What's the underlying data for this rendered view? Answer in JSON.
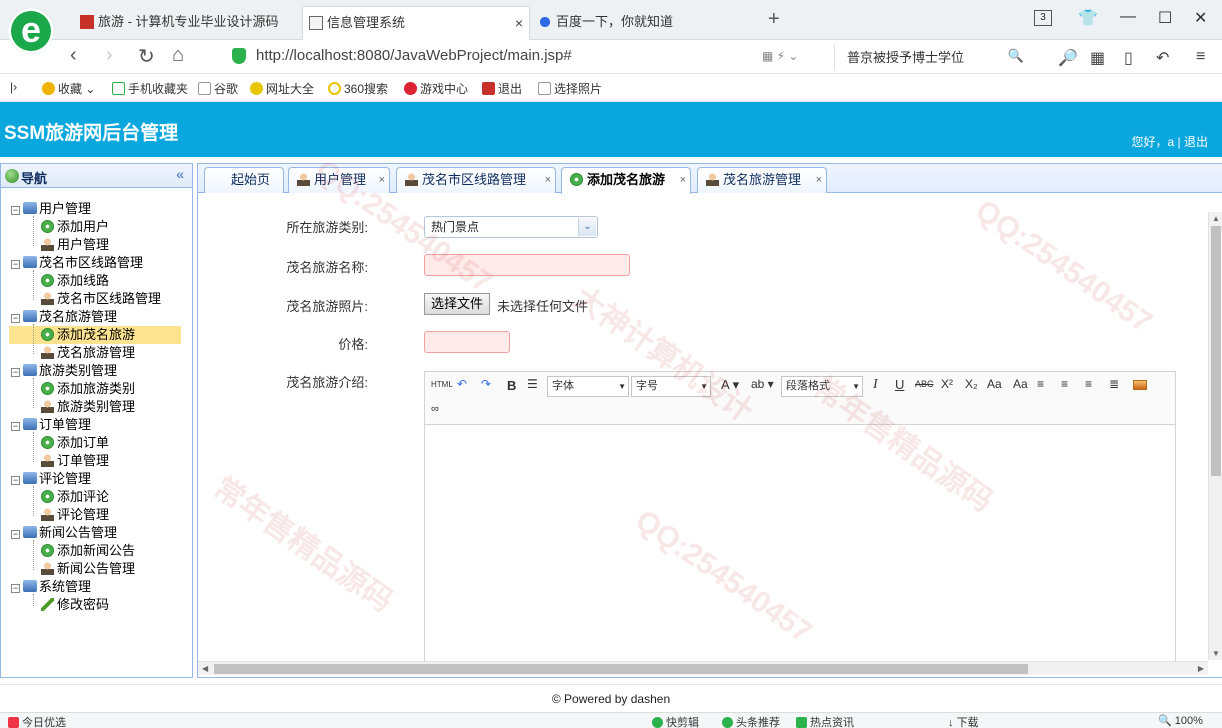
{
  "browser": {
    "tabs": [
      {
        "title": "旅游 - 计算机专业毕业设计源码",
        "active": false
      },
      {
        "title": "信息管理系统",
        "active": true
      },
      {
        "title": "百度一下，你就知道",
        "active": false
      }
    ],
    "tab_count": "3",
    "url": "http://localhost:8080/JavaWebProject/main.jsp#",
    "search_value": "普京被授予博士学位",
    "bookmarks": [
      "收藏",
      "手机收藏夹",
      "谷歌",
      "网址大全",
      "360搜索",
      "游戏中心",
      "退出",
      "选择照片"
    ]
  },
  "app": {
    "title": "SSM旅游网后台管理",
    "greeting": "您好，a |",
    "logout": "退出",
    "footer": "© Powered by dashen"
  },
  "nav": {
    "title": "导航",
    "groups": [
      {
        "label": "用户管理",
        "children": [
          "添加用户",
          "用户管理"
        ]
      },
      {
        "label": "茂名市区线路管理",
        "children": [
          "添加线路",
          "茂名市区线路管理"
        ]
      },
      {
        "label": "茂名旅游管理",
        "children": [
          "添加茂名旅游",
          "茂名旅游管理"
        ]
      },
      {
        "label": "旅游类别管理",
        "children": [
          "添加旅游类别",
          "旅游类别管理"
        ]
      },
      {
        "label": "订单管理",
        "children": [
          "添加订单",
          "订单管理"
        ]
      },
      {
        "label": "评论管理",
        "children": [
          "添加评论",
          "评论管理"
        ]
      },
      {
        "label": "新闻公告管理",
        "children": [
          "添加新闻公告",
          "新闻公告管理"
        ]
      },
      {
        "label": "系统管理",
        "children": [
          "修改密码"
        ]
      }
    ],
    "selected": "添加茂名旅游"
  },
  "tabs": [
    {
      "label": "起始页",
      "closable": false
    },
    {
      "label": "用户管理",
      "closable": true
    },
    {
      "label": "茂名市区线路管理",
      "closable": true
    },
    {
      "label": "添加茂名旅游",
      "closable": true,
      "active": true
    },
    {
      "label": "茂名旅游管理",
      "closable": true
    }
  ],
  "form": {
    "category_label": "所在旅游类别:",
    "category_value": "热门景点",
    "name_label": "茂名旅游名称:",
    "photo_label": "茂名旅游照片:",
    "choose_file": "选择文件",
    "no_file": "未选择任何文件",
    "price_label": "价格:",
    "intro_label": "茂名旅游介绍:"
  },
  "editor": {
    "html": "HTML",
    "font": "字体",
    "size": "字号",
    "paragraph": "段落格式"
  },
  "statusbar": {
    "left": "今日优选",
    "items": [
      "快剪辑",
      "头条推荐",
      "热点资讯",
      "下载"
    ],
    "zoom": "100%"
  },
  "watermarks": [
    "QQ:254540457",
    "大神计算机设计",
    "常年售精品源码"
  ]
}
